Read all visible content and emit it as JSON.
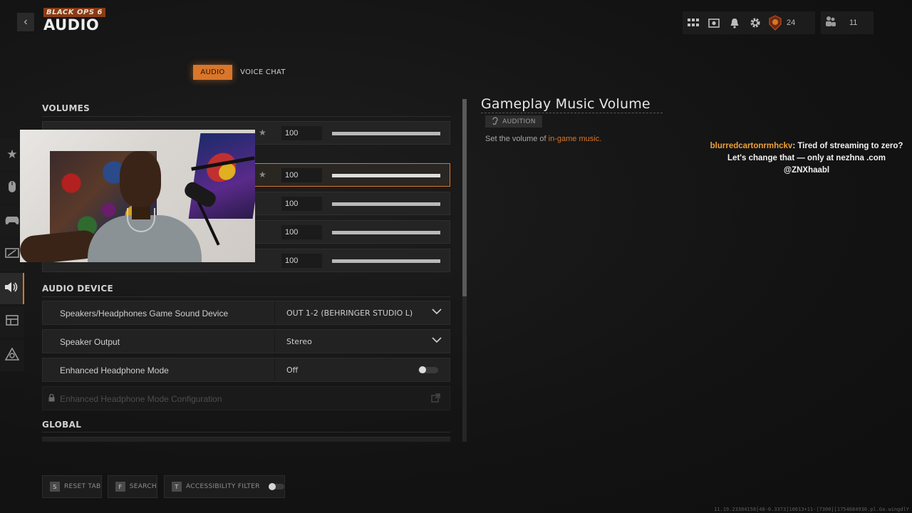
{
  "header": {
    "back_icon": "chevron-left-icon",
    "game_logo": "BLACK OPS 6",
    "title": "AUDIO",
    "topbar_icons": [
      "grid-icon",
      "store-icon",
      "bell-icon",
      "gear-icon"
    ],
    "level": "24",
    "party_count": "11"
  },
  "tabs": [
    {
      "label": "AUDIO",
      "active": true
    },
    {
      "label": "VOICE CHAT",
      "active": false
    }
  ],
  "rail_icons": [
    "star-icon",
    "mouse-icon",
    "controller-icon",
    "display-icon",
    "speaker-icon",
    "interface-icon",
    "network-icon"
  ],
  "sections": {
    "volumes": "VOLUMES",
    "audio_device": "AUDIO DEVICE",
    "global": "GLOBAL"
  },
  "volumes": [
    {
      "value": "100",
      "level": 1.0,
      "starred": true
    },
    {
      "value": "100",
      "level": 1.0,
      "starred": true,
      "focused": true
    },
    {
      "value": "100",
      "level": 1.0
    },
    {
      "value": "100",
      "level": 1.0
    },
    {
      "value": "100",
      "level": 1.0
    }
  ],
  "audio_device": [
    {
      "label": "Speakers/Headphones Game Sound Device",
      "value": "OUT 1-2 (BEHRINGER STUDIO L)"
    },
    {
      "label": "Speaker Output",
      "value": "Stereo"
    },
    {
      "label": "Enhanced Headphone Mode",
      "value": "Off"
    },
    {
      "label": "Enhanced Headphone Mode Configuration"
    }
  ],
  "detail": {
    "title": "Gameplay Music Volume",
    "audition_label": "AUDITION",
    "desc_prefix": "Set the volume of ",
    "desc_highlight": "in-game music."
  },
  "chat": {
    "user": "blurredcartonrmhckv",
    "message": ": Tired of streaming to zero? Let's change that — only at nezhna .com @ZNXhaabl"
  },
  "footer": {
    "reset_key": "S",
    "reset_label": "RESET TAB",
    "search_key": "F",
    "search_label": "SEARCH",
    "filter_key": "T",
    "filter_label": "ACCESSIBILITY FILTER",
    "build": "11.19.23384158[48-0.3373]10613+11-[7300][1754684930.pl.Ga.wingdlY"
  },
  "colors": {
    "accent": "#d9762a",
    "chat_user": "#f0a13a"
  }
}
